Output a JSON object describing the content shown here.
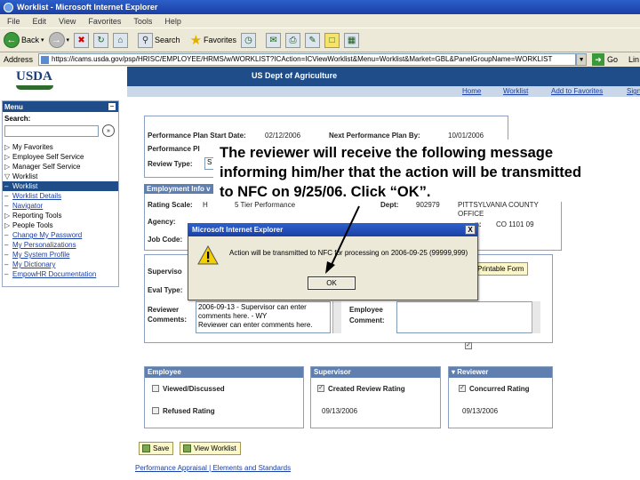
{
  "window": {
    "title": "Worklist - Microsoft Internet Explorer"
  },
  "menubar": [
    "File",
    "Edit",
    "View",
    "Favorites",
    "Tools",
    "Help"
  ],
  "toolbar": {
    "back": "Back",
    "search": "Search",
    "favorites": "Favorites"
  },
  "address": {
    "label": "Address",
    "url": "https://icams.usda.gov/psp/HRISC/EMPLOYEE/HRMS/w/WORKLIST?ICAction=ICViewWorklist&Menu=Worklist&Market=GBL&PanelGroupName=WORKLIST",
    "go": "Go",
    "links": "Lin"
  },
  "banner": {
    "logo": "USDA",
    "title": "US Dept of Agriculture",
    "nav": [
      "Home",
      "Worklist",
      "Add to Favorites",
      "Sign"
    ]
  },
  "leftmenu": {
    "header": "Menu",
    "search_label": "Search:",
    "items": [
      {
        "prefix": "▷",
        "label": "My Favorites",
        "link": false,
        "selected": false
      },
      {
        "prefix": "▷",
        "label": "Employee Self Service",
        "link": false,
        "selected": false
      },
      {
        "prefix": "▷",
        "label": "Manager Self Service",
        "link": false,
        "selected": false
      },
      {
        "prefix": "▽",
        "label": "Worklist",
        "link": false,
        "selected": false
      },
      {
        "prefix": "–",
        "label": "Worklist",
        "link": false,
        "selected": true
      },
      {
        "prefix": "–",
        "label": "Worklist Details",
        "link": true,
        "selected": false
      },
      {
        "prefix": "–",
        "label": "Navigator",
        "link": true,
        "selected": false
      },
      {
        "prefix": "▷",
        "label": "Reporting Tools",
        "link": false,
        "selected": false
      },
      {
        "prefix": "▷",
        "label": "People Tools",
        "link": false,
        "selected": false
      },
      {
        "prefix": "–",
        "label": "Change My Password",
        "link": true,
        "selected": false
      },
      {
        "prefix": "–",
        "label": "My Personalizations",
        "link": true,
        "selected": false
      },
      {
        "prefix": "–",
        "label": "My System Profile",
        "link": true,
        "selected": false
      },
      {
        "prefix": "–",
        "label": "My Dictionary",
        "link": true,
        "selected": false
      },
      {
        "prefix": "–",
        "label": "EmpowHR Documentation",
        "link": true,
        "selected": false
      }
    ]
  },
  "plan": {
    "start_label": "Performance Plan Start Date:",
    "start_value": "02/12/2006",
    "next_label": "Next Performance Plan By:",
    "next_value": "10/01/2006",
    "plan_label": "Performance Pl",
    "review_type_label": "Review Type:",
    "review_type_value": "S"
  },
  "employment": {
    "section_title": "Employment Info v",
    "rating_scale_label": "Rating Scale:",
    "rating_scale_value": "H",
    "rating_scale_desc": "5 Tier Performance",
    "dept_label": "Dept:",
    "dept_value": "902979",
    "dept_name": "PITTSYLVANIA COUNTY OFFICE",
    "agency_label": "Agency:",
    "location_value": "CO  1101 09",
    "location_label": "n:",
    "job_code_label": "Job Code:"
  },
  "comments": {
    "supervisor_label": "Superviso",
    "eval_type_label": "Eval Type:",
    "printable_form": "Printable Form",
    "reviewer_label": "Reviewer",
    "comments_label": "Comments:",
    "reviewer_text": "2006-09-13 - Supervisor can enter comments here. - WY\nReviewer can enter comments here.",
    "employee_label": "Employee",
    "employee_comment_label": "Comment:"
  },
  "panels": {
    "employee": {
      "title": "Employee",
      "check1": "Viewed/Discussed",
      "check2": "Refused Rating"
    },
    "supervisor": {
      "title": "Supervisor",
      "check1": "Created Review Rating",
      "date": "09/13/2006"
    },
    "reviewer": {
      "title": "Reviewer",
      "check1": "Concurred Rating",
      "date": "09/13/2006"
    }
  },
  "buttons": {
    "save": "Save",
    "view_worklist": "View Worklist"
  },
  "footer_link": "Performance Appraisal | Elements and Standards",
  "dialog": {
    "title": "Microsoft Internet Explorer",
    "message": "Action will be transmitted to NFC for processing on 2006-09-25 (99999,999)",
    "ok": "OK",
    "close": "X"
  },
  "callout": {
    "line1": "The reviewer will receive the following message",
    "line2": "informing him/her that the action will be transmitted",
    "line3": "to NFC on 9/25/06.  Click “OK”."
  },
  "colors": {
    "banner": "#1f4d8a",
    "section_header": "#5f7fb0",
    "button_bg": "#fbf7c8"
  }
}
